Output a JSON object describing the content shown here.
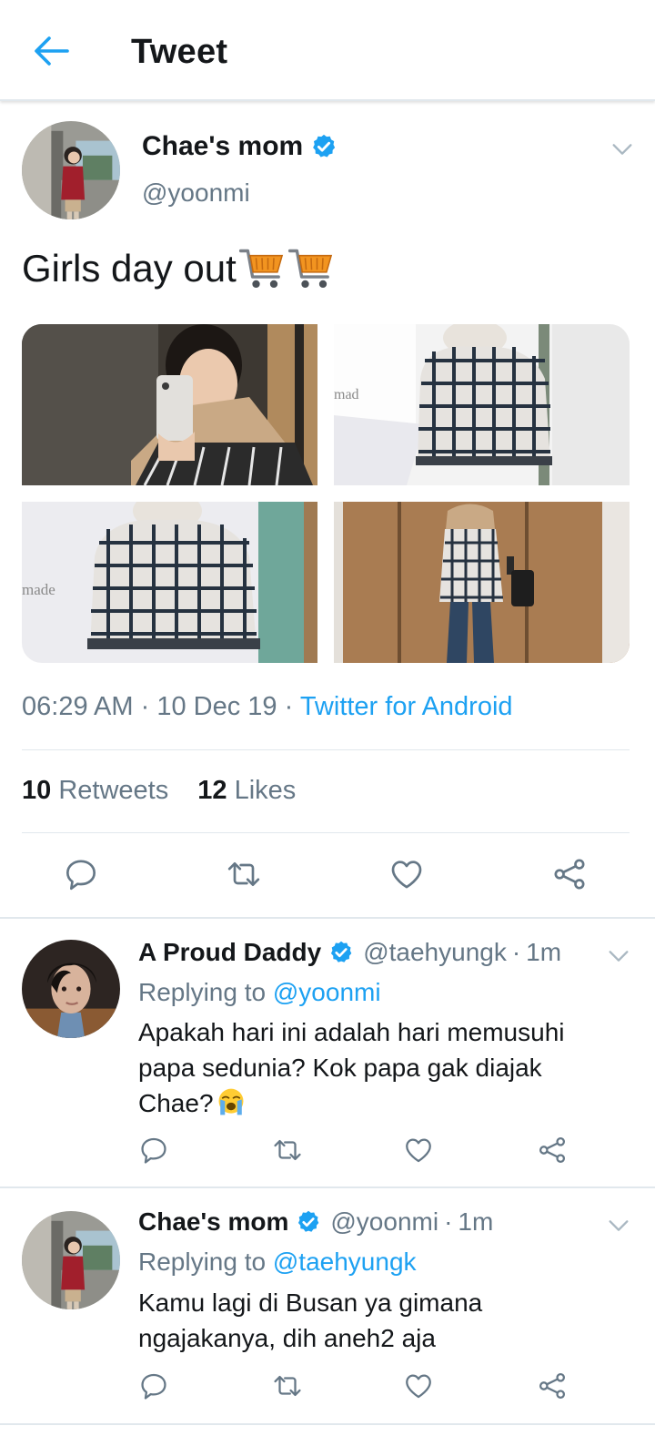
{
  "header": {
    "title": "Tweet",
    "back_icon": "arrow-left-icon"
  },
  "colors": {
    "accent": "#1da1f2",
    "text": "#14171a",
    "secondary": "#657786",
    "divider": "#e1e8ed"
  },
  "tweet": {
    "author_name": "Chae's mom",
    "author_handle": "@yoonmi",
    "verified": true,
    "text": "Girls day out",
    "text_emojis": [
      "shopping-cart",
      "shopping-cart"
    ],
    "photos": [
      {
        "subject": "mirror selfie with phone"
      },
      {
        "subject": "plaid coat on bed",
        "watermark": "mad"
      },
      {
        "subject": "plaid coat close-up",
        "watermark": "made"
      },
      {
        "subject": "full-length mirror outfit"
      }
    ],
    "time": "06:29 AM",
    "date": "10 Dec 19",
    "separator": "·",
    "source": "Twitter for Android",
    "retweets_count": "10",
    "retweets_label": "Retweets",
    "likes_count": "12",
    "likes_label": "Likes",
    "actions": [
      "reply-icon",
      "retweet-icon",
      "like-icon",
      "share-icon"
    ]
  },
  "replies": [
    {
      "author_name": "A Proud Daddy",
      "author_handle": "@taehyungk",
      "time_ago": "1m",
      "verified": true,
      "replying_prefix": "Replying to",
      "replying_to": "@yoonmi",
      "text": "Apakah hari ini adalah hari memusuhi papa sedunia? Kok papa gak diajak Chae?",
      "text_emoji": "loudly-crying-face"
    },
    {
      "author_name": "Chae's mom",
      "author_handle": "@yoonmi",
      "time_ago": "1m",
      "verified": true,
      "replying_prefix": "Replying to",
      "replying_to": "@taehyungk",
      "text": "Kamu lagi di Busan ya gimana ngajakanya, dih aneh2 aja"
    }
  ]
}
